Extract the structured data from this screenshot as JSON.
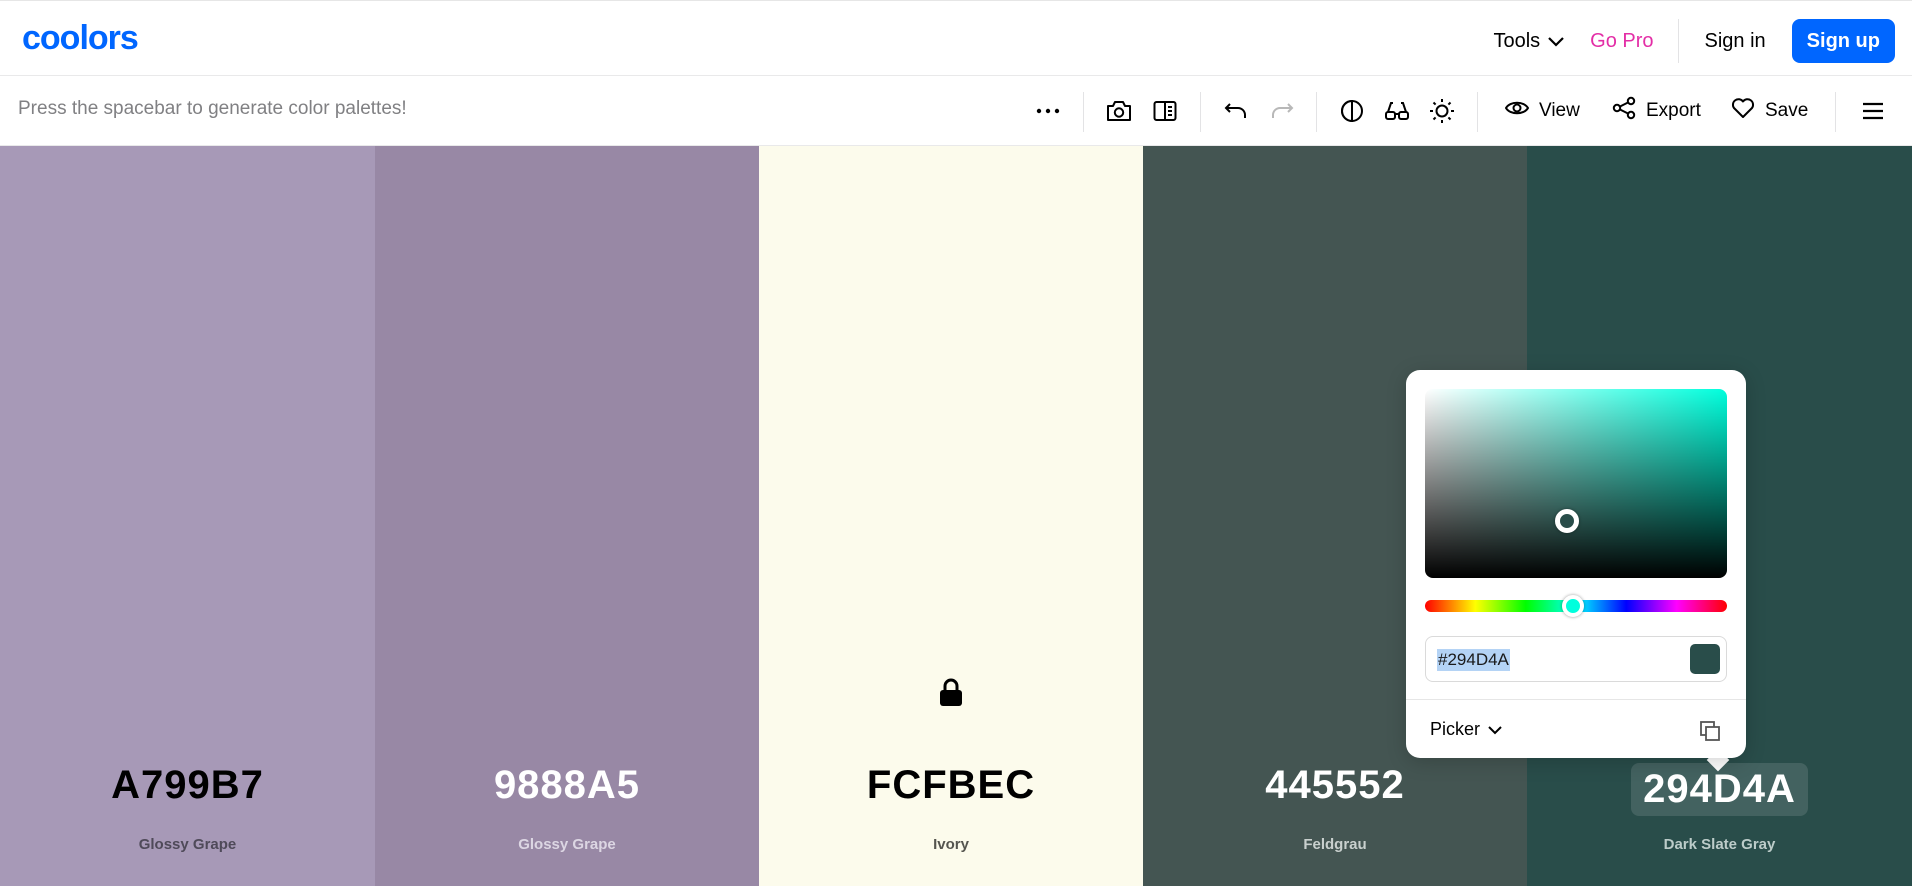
{
  "app": {
    "logo_text": "coolors"
  },
  "nav": {
    "tools_label": "Tools",
    "gopro_label": "Go Pro",
    "signin_label": "Sign in",
    "signup_label": "Sign up"
  },
  "toolbar": {
    "hint": "Press the spacebar to generate color palettes!",
    "view_label": "View",
    "export_label": "Export",
    "save_label": "Save",
    "icons": [
      "more-icon",
      "camera-icon",
      "compare-icon",
      "undo-icon",
      "redo-icon",
      "contrast-icon",
      "glasses-icon",
      "brightness-icon",
      "eye-icon",
      "share-icon",
      "heart-icon",
      "menu-icon"
    ]
  },
  "palette": {
    "colors": [
      {
        "hex": "A799B7",
        "name": "Glossy Grape",
        "bg": "#a799b7",
        "fg": "#000000",
        "name_color": "#4f4a59",
        "locked": false
      },
      {
        "hex": "9888A5",
        "name": "Glossy Grape",
        "bg": "#9888a5",
        "fg": "#ffffff",
        "name_color": "#dcd6e3",
        "locked": false
      },
      {
        "hex": "FCFBEC",
        "name": "Ivory",
        "bg": "#fcfbec",
        "fg": "#000000",
        "name_color": "#55554f",
        "locked": true
      },
      {
        "hex": "445552",
        "name": "Feldgrau",
        "bg": "#445552",
        "fg": "#ffffff",
        "name_color": "#c9d0ce",
        "locked": false
      },
      {
        "hex": "294D4A",
        "name": "Dark Slate Gray",
        "bg": "#294d4a",
        "fg": "#ffffff",
        "name_color": "#bcccc9",
        "locked": false
      }
    ]
  },
  "picker": {
    "hex_value": "#294D4A",
    "swatch_color": "#294d4a",
    "mode_label": "Picker",
    "hue_color": "#00ffdd",
    "saturation": 0.47,
    "brightness": 0.3,
    "hue_fraction": 0.49
  }
}
